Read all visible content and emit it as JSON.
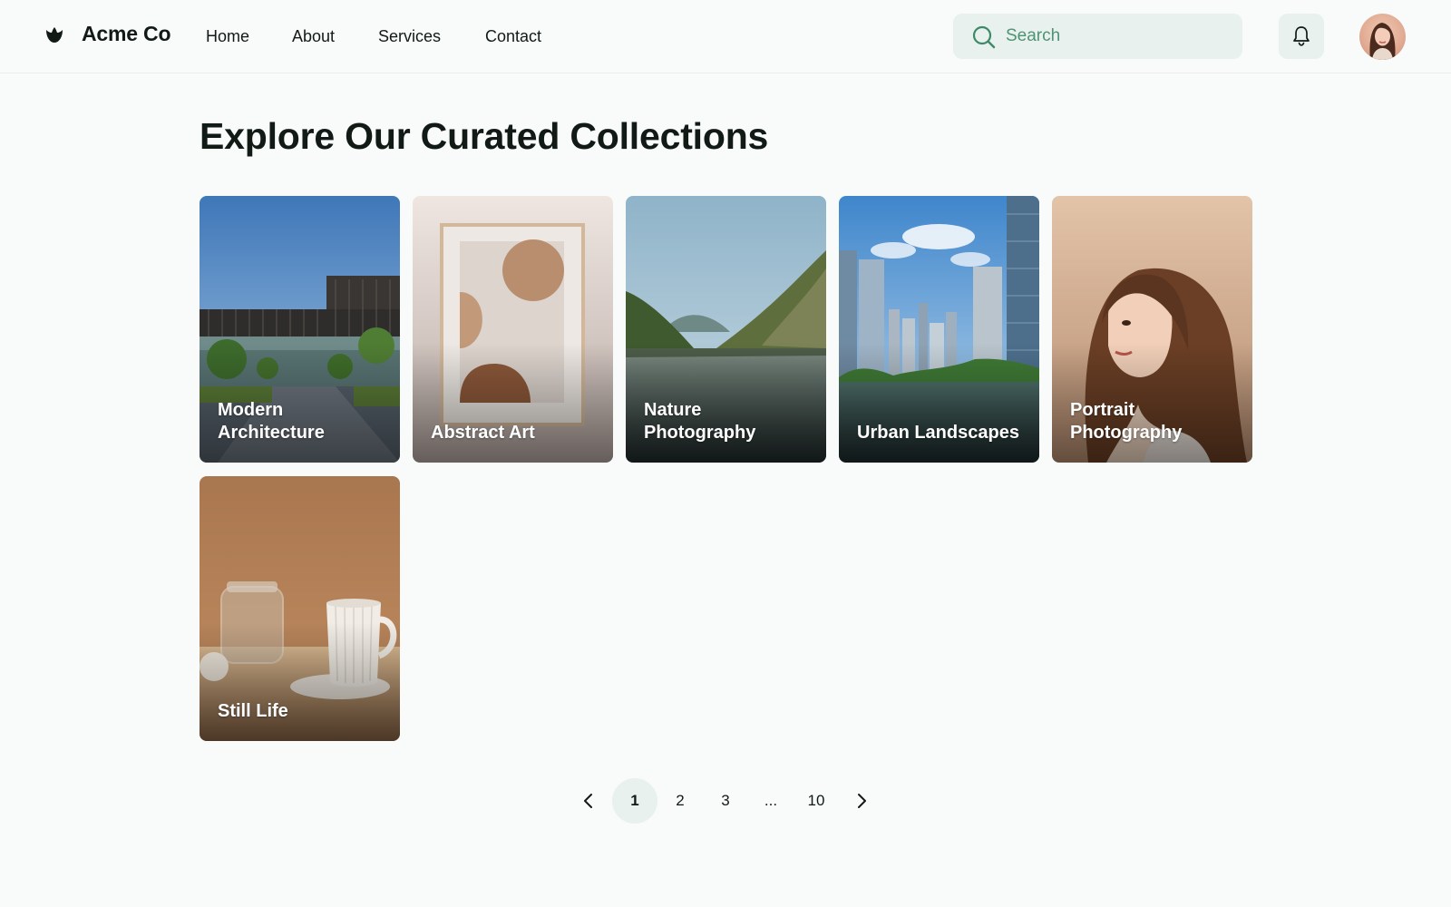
{
  "header": {
    "brand": "Acme Co",
    "nav": [
      "Home",
      "About",
      "Services",
      "Contact"
    ],
    "search_placeholder": "Search",
    "icons": {
      "logo": "leaf-logo-icon",
      "search": "search-icon",
      "bell": "bell-icon"
    }
  },
  "main": {
    "title": "Explore Our Curated Collections",
    "collections": [
      {
        "label": "Modern Architecture"
      },
      {
        "label": "Abstract Art"
      },
      {
        "label": "Nature Photography"
      },
      {
        "label": "Urban Landscapes"
      },
      {
        "label": "Portrait Photography"
      },
      {
        "label": "Still Life"
      }
    ]
  },
  "pagination": {
    "pages": [
      "1",
      "2",
      "3",
      "...",
      "10"
    ],
    "current": "1",
    "icons": {
      "prev": "chevron-left-icon",
      "next": "chevron-right-icon"
    }
  },
  "colors": {
    "background": "#f8fbfa",
    "accent_surface": "#e8f1ed",
    "search_text": "#4e9474",
    "text": "#121a16"
  }
}
